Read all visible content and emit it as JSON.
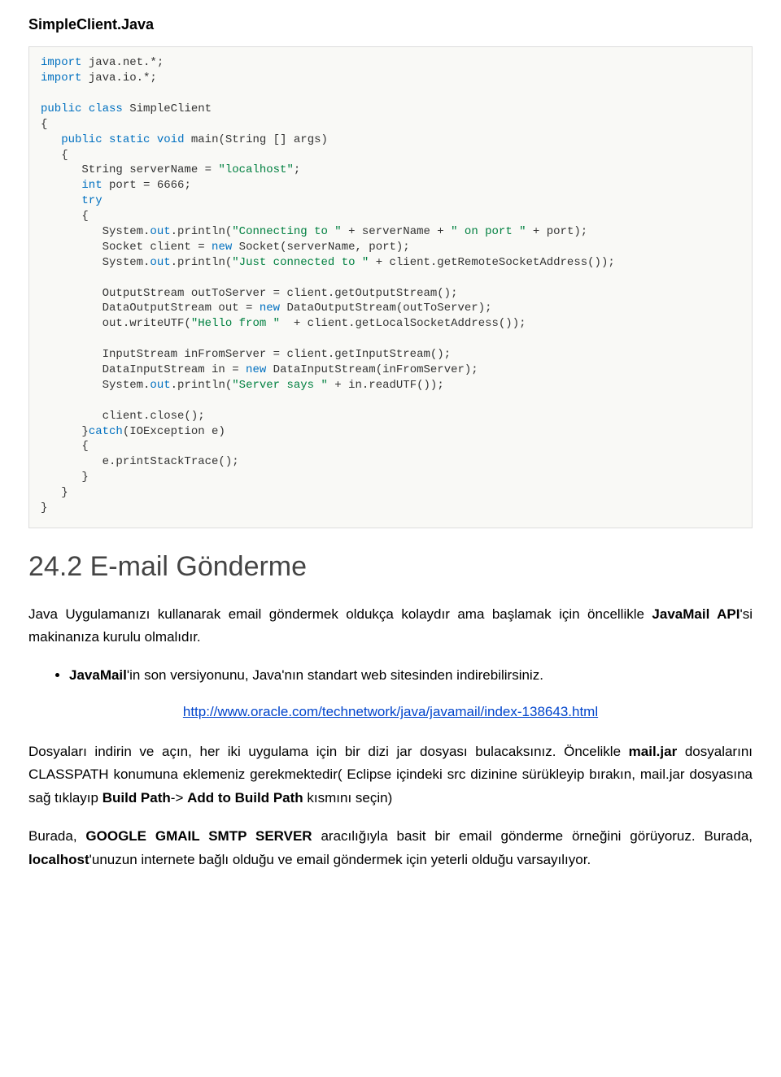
{
  "filename_title": "SimpleClient.Java",
  "code": {
    "l1_a": "import",
    "l1_b": " java.net.*;",
    "l2_a": "import",
    "l2_b": " java.io.*;",
    "l3_a": "public",
    "l3_b": " ",
    "l3_c": "class",
    "l3_d": " SimpleClient",
    "l4": "{",
    "l5_a": "   public",
    "l5_b": " ",
    "l5_c": "static",
    "l5_d": " ",
    "l5_e": "void",
    "l5_f": " main(String [] args)",
    "l6": "   {",
    "l7_a": "      String serverName = ",
    "l7_b": "\"localhost\"",
    "l7_c": ";",
    "l8_a": "      int",
    "l8_b": " port = 6666;",
    "l9_a": "      try",
    "l10": "      {",
    "l11_a": "         System.",
    "l11_b": "out",
    "l11_c": ".println(",
    "l11_d": "\"Connecting to \"",
    "l11_e": " + serverName + ",
    "l11_f": "\" on port \"",
    "l11_g": " + port);",
    "l12_a": "         Socket client = ",
    "l12_b": "new",
    "l12_c": " Socket(serverName, port);",
    "l13_a": "         System.",
    "l13_b": "out",
    "l13_c": ".println(",
    "l13_d": "\"Just connected to \"",
    "l13_e": " + client.getRemoteSocketAddress());",
    "blank1": "",
    "l14": "         OutputStream outToServer = client.getOutputStream();",
    "l15_a": "         DataOutputStream out = ",
    "l15_b": "new",
    "l15_c": " DataOutputStream(outToServer);",
    "l16_a": "         out.writeUTF(",
    "l16_b": "\"Hello from \"",
    "l16_c": "  + client.getLocalSocketAddress());",
    "blank2": "",
    "l17": "         InputStream inFromServer = client.getInputStream();",
    "l18_a": "         DataInputStream in = ",
    "l18_b": "new",
    "l18_c": " DataInputStream(inFromServer);",
    "l19_a": "         System.",
    "l19_b": "out",
    "l19_c": ".println(",
    "l19_d": "\"Server says \"",
    "l19_e": " + in.readUTF());",
    "blank3": "",
    "l20": "         client.close();",
    "l21_a": "      }",
    "l21_b": "catch",
    "l21_c": "(IOException e)",
    "l22": "      {",
    "l23": "         e.printStackTrace();",
    "l24": "      }",
    "l25": "   }",
    "l26": "}"
  },
  "section_heading": "24.2 E-mail Gönderme",
  "para1_a": "Java Uygulamanızı kullanarak email göndermek oldukça kolaydır ama başlamak için öncellikle ",
  "para1_bold": "JavaMail API",
  "para1_b": "'si makinanıza kurulu olmalıdır.",
  "bullet1_bold": "JavaMail",
  "bullet1_text": "'in son versiyonunu, Java'nın standart web sitesinden indirebilirsiniz.",
  "link_text": "http://www.oracle.com/technetwork/java/javamail/index-138643.html",
  "para2_a": "Dosyaları indirin ve açın, her iki uygulama için bir dizi jar dosyası bulacaksınız. Öncelikle ",
  "para2_bold1": "mail.jar",
  "para2_b": " dosyalarını CLASSPATH konumuna eklemeniz gerekmektedir( Eclipse içindeki src dizinine sürükleyip bırakın, mail.jar dosyasına sağ tıklayıp ",
  "para2_bold2": "Build Path",
  "para2_c": "-> ",
  "para2_bold3": "Add to Build Path",
  "para2_d": " kısmını seçin)",
  "para3_a": "Burada, ",
  "para3_bold1": "GOOGLE GMAIL SMTP SERVER",
  "para3_b": " aracılığıyla basit bir email gönderme örneğini görüyoruz. Burada, ",
  "para3_bold2": "localhost",
  "para3_c": "'unuzun internete bağlı olduğu ve email göndermek için yeterli olduğu varsayılıyor."
}
